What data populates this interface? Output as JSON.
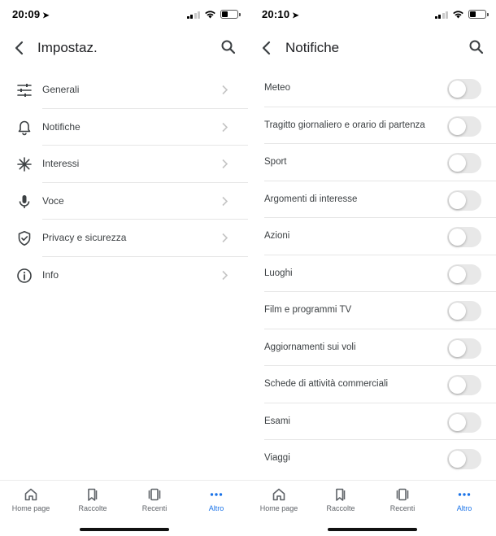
{
  "colors": {
    "accent": "#1a73e8",
    "text": "#3c4043",
    "toggle_off": "#e8e8e8"
  },
  "left_screen": {
    "status": {
      "time": "20:09"
    },
    "header": {
      "title": "Impostaz."
    },
    "items": [
      {
        "label": "Generali",
        "icon": "sliders-icon"
      },
      {
        "label": "Notifiche",
        "icon": "bell-icon"
      },
      {
        "label": "Interessi",
        "icon": "asterisk-icon"
      },
      {
        "label": "Voce",
        "icon": "microphone-icon"
      },
      {
        "label": "Privacy e sicurezza",
        "icon": "shield-icon"
      },
      {
        "label": "Info",
        "icon": "info-icon"
      }
    ]
  },
  "right_screen": {
    "status": {
      "time": "20:10"
    },
    "header": {
      "title": "Notifiche"
    },
    "items": [
      {
        "label": "Meteo",
        "enabled": false
      },
      {
        "label": "Tragitto giornaliero e orario di partenza",
        "enabled": false
      },
      {
        "label": "Sport",
        "enabled": false
      },
      {
        "label": "Argomenti di interesse",
        "enabled": false
      },
      {
        "label": "Azioni",
        "enabled": false
      },
      {
        "label": "Luoghi",
        "enabled": false
      },
      {
        "label": "Film e programmi TV",
        "enabled": false
      },
      {
        "label": "Aggiornamenti sui voli",
        "enabled": false
      },
      {
        "label": "Schede di attività commerciali",
        "enabled": false
      },
      {
        "label": "Esami",
        "enabled": false
      },
      {
        "label": "Viaggi",
        "enabled": false
      }
    ]
  },
  "bottom_nav": {
    "items": [
      {
        "label": "Home page",
        "icon": "home-icon"
      },
      {
        "label": "Raccolte",
        "icon": "bookmark-icon"
      },
      {
        "label": "Recenti",
        "icon": "recent-cards-icon"
      },
      {
        "label": "Altro",
        "icon": "more-dots-icon",
        "active": true
      }
    ]
  }
}
